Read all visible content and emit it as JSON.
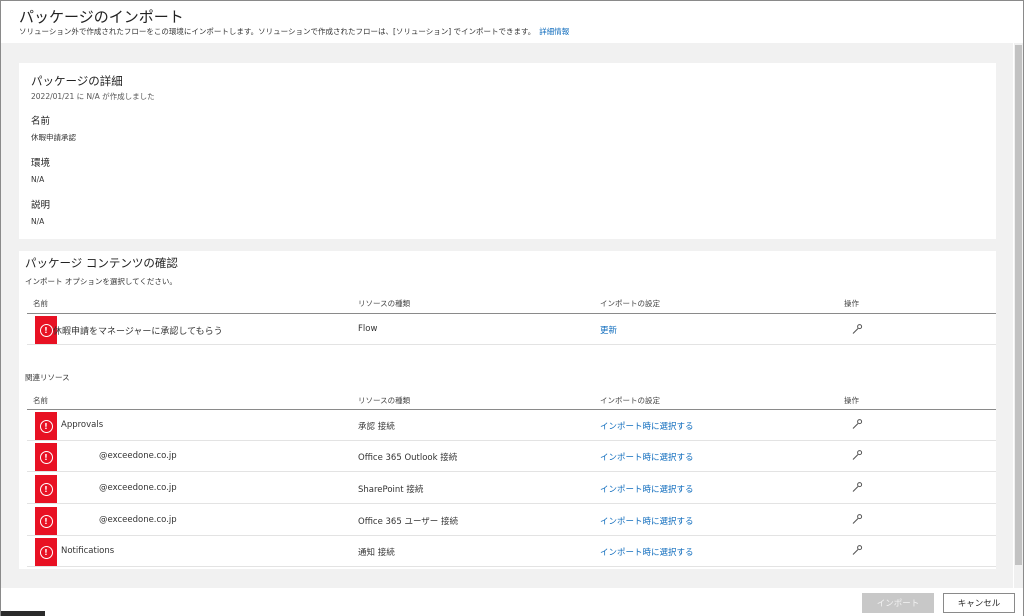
{
  "header": {
    "title": "パッケージのインポート",
    "subtitle": "ソリューション外で作成されたフローをこの環境にインポートします。ソリューションで作成されたフローは、[ソリューション] でインポートできます。",
    "learn_more": "詳細情報"
  },
  "details": {
    "heading": "パッケージの詳細",
    "created": "2022/01/21 に N/A が作成しました",
    "name_label": "名前",
    "name_value": "休暇申請承認",
    "env_label": "環境",
    "env_value": "N/A",
    "desc_label": "説明",
    "desc_value": "N/A"
  },
  "contents": {
    "heading": "パッケージ コンテンツの確認",
    "instruction": "インポート オプションを選択してください。",
    "columns": [
      "名前",
      "リソースの種類",
      "インポートの設定",
      "操作"
    ],
    "main_rows": [
      {
        "name": "休暇申請をマネージャーに承認してもらう",
        "type": "Flow",
        "setting": "更新"
      }
    ],
    "related_heading": "関連リソース",
    "related_rows": [
      {
        "name": "Approvals",
        "type": "承認 接続",
        "setting": "インポート時に選択する"
      },
      {
        "name": "@exceedone.co.jp",
        "type": "Office 365 Outlook 接続",
        "setting": "インポート時に選択する"
      },
      {
        "name": "@exceedone.co.jp",
        "type": "SharePoint 接続",
        "setting": "インポート時に選択する"
      },
      {
        "name": "@exceedone.co.jp",
        "type": "Office 365 ユーザー 接続",
        "setting": "インポート時に選択する"
      },
      {
        "name": "Notifications",
        "type": "通知 接続",
        "setting": "インポート時に選択する"
      }
    ]
  },
  "footer": {
    "import_label": "インポート",
    "cancel_label": "キャンセル"
  },
  "colors": {
    "error": "#e81123",
    "link": "#0f6cbd",
    "canvas": "#f1f1f1"
  },
  "icons": {
    "error": "error-circle-icon",
    "action": "wrench-icon"
  }
}
